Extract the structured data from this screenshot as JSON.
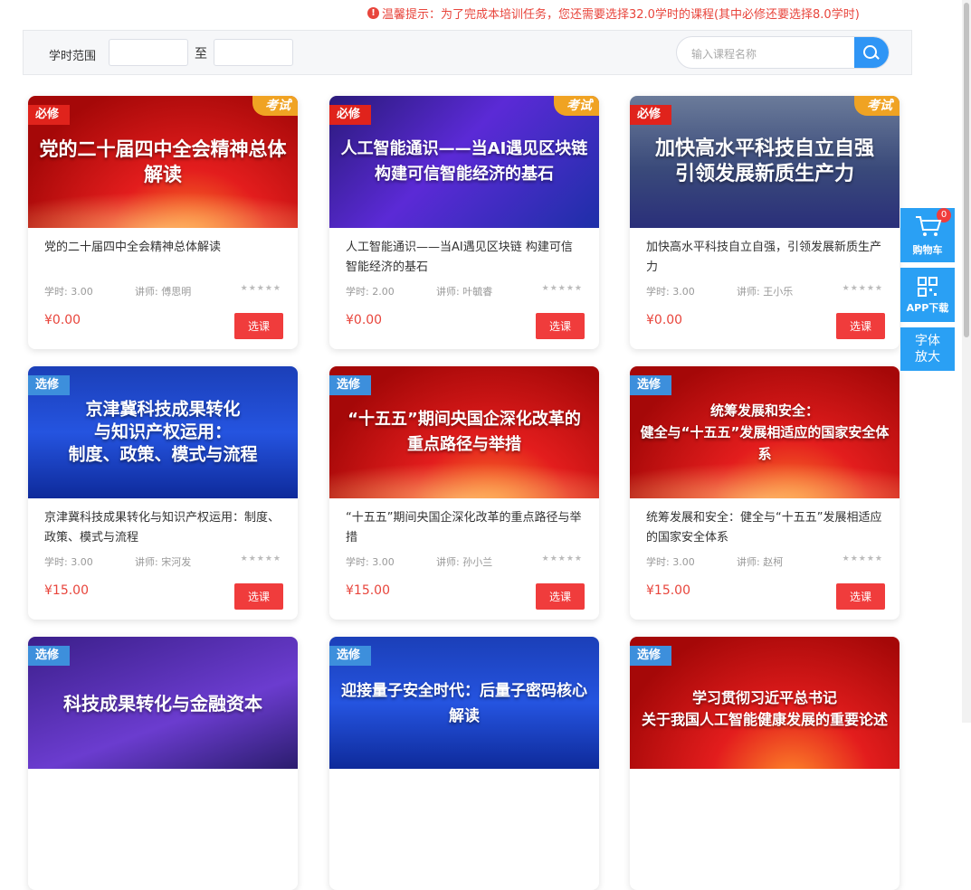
{
  "notice": "温馨提示：为了完成本培训任务，您还需要选择32.0学时的课程(其中必修还要选择8.0学时)",
  "filter": {
    "hours_label": "学时范围",
    "to_label": "至",
    "search_placeholder": "输入课程名称"
  },
  "colors": {
    "accent": "#2aa0f4",
    "price": "#e8453c",
    "button": "#f03c3c",
    "required": "#e0231c",
    "optional": "#3d8fdc",
    "exam": "#f0a323"
  },
  "courses": [
    {
      "tag": "必修",
      "exam": "考试",
      "banner": "党的二十届四中全会精神总体解读",
      "title": "党的二十届四中全会精神总体解读",
      "hours": "学时: 3.00",
      "teacher": "讲师: 傅思明",
      "price": "¥0.00",
      "button": "选课"
    },
    {
      "tag": "必修",
      "exam": "考试",
      "banner": "人工智能通识——当AI遇见区块链\n构建可信智能经济的基石",
      "title": "人工智能通识——当AI遇见区块链 构建可信智能经济的基石",
      "hours": "学时: 2.00",
      "teacher": "讲师: 叶毓睿",
      "price": "¥0.00",
      "button": "选课"
    },
    {
      "tag": "必修",
      "exam": "考试",
      "banner": "加快高水平科技自立自强\n引领发展新质生产力",
      "title": "加快高水平科技自立自强，引领发展新质生产力",
      "hours": "学时: 3.00",
      "teacher": "讲师: 王小乐",
      "price": "¥0.00",
      "button": "选课"
    },
    {
      "tag": "选修",
      "banner": "京津冀科技成果转化\n与知识产权运用：\n制度、政策、模式与流程",
      "title": "京津冀科技成果转化与知识产权运用：制度、政策、模式与流程",
      "hours": "学时: 3.00",
      "teacher": "讲师: 宋河发",
      "price": "¥15.00",
      "button": "选课"
    },
    {
      "tag": "选修",
      "banner": "“十五五”期间央国企深化改革的\n重点路径与举措",
      "title": "“十五五”期间央国企深化改革的重点路径与举措",
      "hours": "学时: 3.00",
      "teacher": "讲师: 孙小兰",
      "price": "¥15.00",
      "button": "选课"
    },
    {
      "tag": "选修",
      "banner": "统筹发展和安全：\n健全与“十五五”发展相适应的国家安全体系",
      "title": "统筹发展和安全：健全与“十五五”发展相适应的国家安全体系",
      "hours": "学时: 3.00",
      "teacher": "讲师: 赵柯",
      "price": "¥15.00",
      "button": "选课"
    },
    {
      "tag": "选修",
      "banner": "科技成果转化与金融资本"
    },
    {
      "tag": "选修",
      "banner": "迎接量子安全时代：后量子密码核心解读"
    },
    {
      "tag": "选修",
      "banner": "学习贯彻习近平总书记\n关于我国人工智能健康发展的重要论述"
    }
  ],
  "sidebar": {
    "cart_count": "0",
    "cart_label": "购物车",
    "app_label": "APP下载",
    "font_label": "字体放大"
  }
}
